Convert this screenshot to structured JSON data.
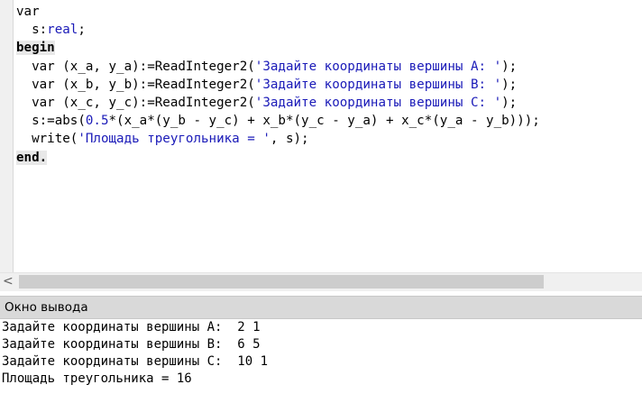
{
  "editor": {
    "lines": [
      {
        "t1": "var"
      },
      {
        "t1": "  s:",
        "t2": "real",
        "t3": ";"
      },
      {
        "t1": "begin"
      },
      {
        "t1": "  var (x_a, y_a):=ReadInteger2(",
        "t2": "'Задайте координаты вершины A: '",
        "t3": ");"
      },
      {
        "t1": "  var (x_b, y_b):=ReadInteger2(",
        "t2": "'Задайте координаты вершины B: '",
        "t3": ");"
      },
      {
        "t1": "  var (x_c, y_c):=ReadInteger2(",
        "t2": "'Задайте координаты вершины C: '",
        "t3": ");"
      },
      {
        "t1": "  s:=abs(",
        "t2": "0.5",
        "t3": "*(x_a*(y_b - y_c) + x_b*(y_c - y_a) + x_c*(y_a - y_b)));"
      },
      {
        "t1": "  write(",
        "t2": "'Площадь треугольника = '",
        "t3": ", s);"
      },
      {
        "t1": "end."
      }
    ]
  },
  "scrollbar": {
    "left_arrow": "<"
  },
  "output_panel": {
    "title": "Окно вывода",
    "lines": [
      "Задайте координаты вершины A:  2 1",
      "Задайте координаты вершины B:  6 5",
      "Задайте координаты вершины C:  10 1",
      "Площадь треугольника = 16"
    ]
  }
}
